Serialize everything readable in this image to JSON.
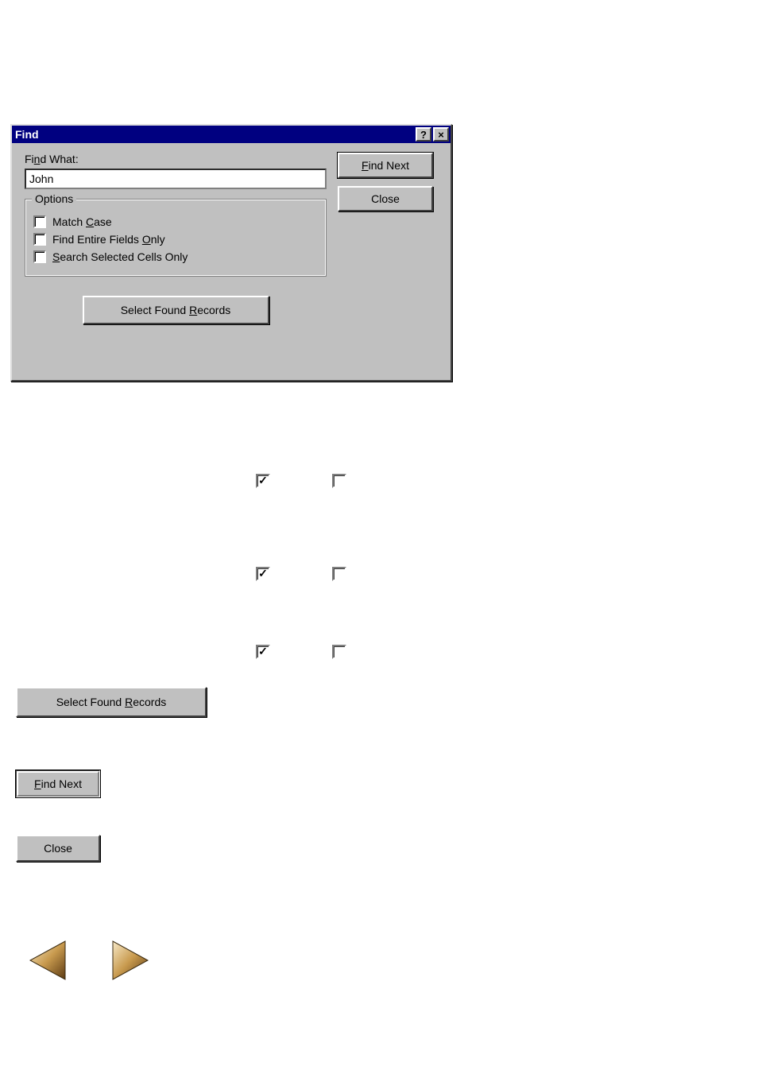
{
  "dialog": {
    "title": "Find",
    "titlebar": {
      "help": "?",
      "close": "×"
    },
    "find_what_label": "Find What:",
    "find_what_value": "John",
    "options_group_label": "Options",
    "checkboxes": {
      "match_case": {
        "label": "Match Case",
        "checked": false
      },
      "find_entire_fields": {
        "label": "Find Entire Fields Only",
        "checked": false
      },
      "search_selected_cells": {
        "label": "Search Selected Cells Only",
        "checked": false
      }
    },
    "select_records_label": "Select Found Records",
    "find_next_label": "Find Next",
    "close_label": "Close"
  },
  "demo_checkboxes": {
    "a1": true,
    "b1": false,
    "a2": true,
    "b2": false,
    "a3": true,
    "b3": false
  },
  "standalone_buttons": {
    "select_records": "Select Found Records",
    "find_next": "Find Next",
    "close": "Close"
  }
}
